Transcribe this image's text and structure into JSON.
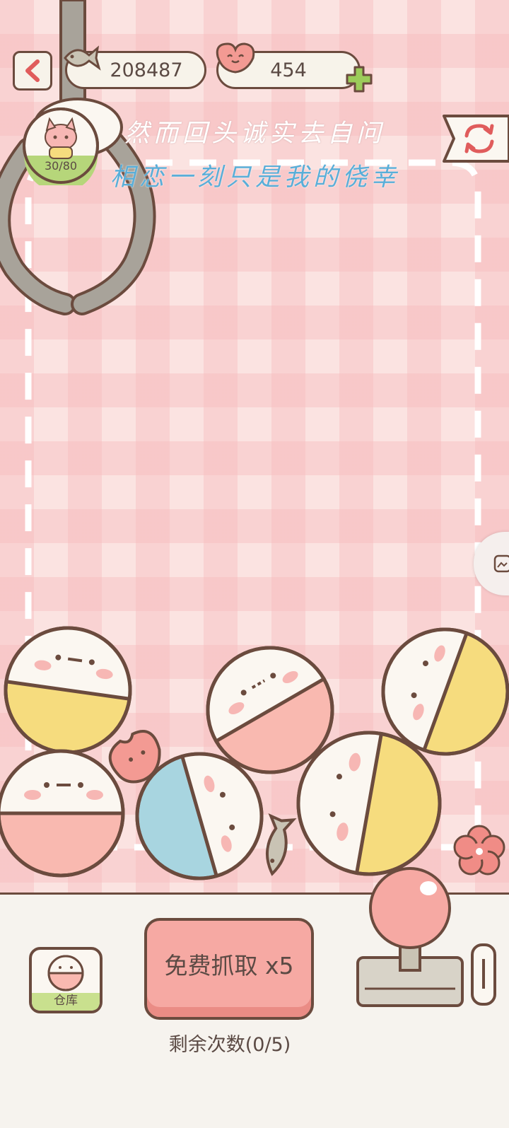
{
  "header": {
    "fish_count": "208487",
    "heart_count": "454"
  },
  "claw_counter": "30/80",
  "lyrics": {
    "line1": "然而回头诚实去自问",
    "line2": "相恋一刻只是我的侥幸"
  },
  "controls": {
    "grab_label": "免费抓取 x5",
    "remaining_label": "剩余次数(0/5)",
    "warehouse_label": "仓库"
  },
  "colors": {
    "outline": "#6b4b3e",
    "pink": "#f6a9a3",
    "yellow": "#f6dc7e",
    "blue": "#a8d5e0",
    "green": "#9ccc5a"
  }
}
